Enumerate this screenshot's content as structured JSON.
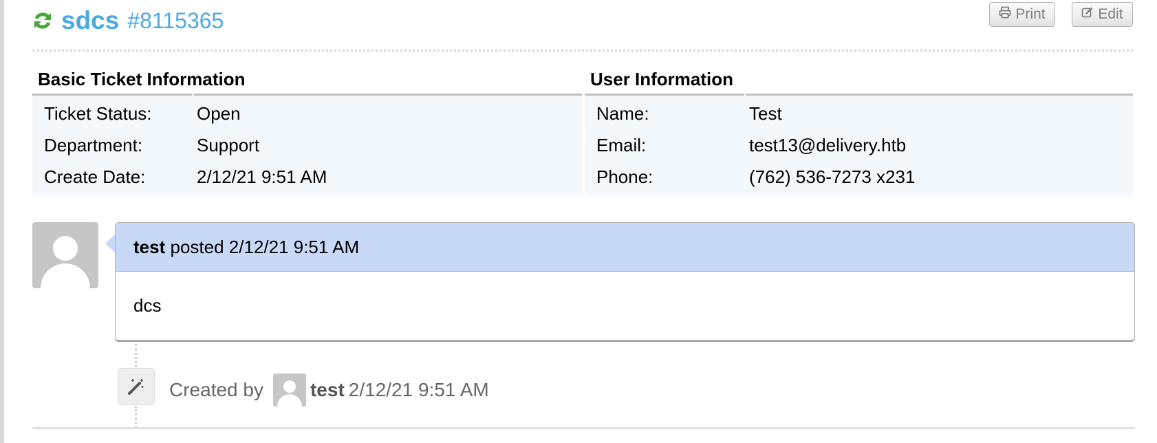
{
  "ticket": {
    "title": "sdcs",
    "number": "#8115365"
  },
  "header_buttons": {
    "print_label": "Print",
    "edit_label": "Edit"
  },
  "basic_info": {
    "heading": "Basic Ticket Information",
    "rows": [
      {
        "label": "Ticket Status:",
        "value": "Open"
      },
      {
        "label": "Department:",
        "value": "Support"
      },
      {
        "label": "Create Date:",
        "value": "2/12/21 9:51 AM"
      }
    ]
  },
  "user_info": {
    "heading": "User Information",
    "rows": [
      {
        "label": "Name:",
        "value": "Test"
      },
      {
        "label": "Email:",
        "value": "test13@delivery.htb"
      },
      {
        "label": "Phone:",
        "value": "(762) 536-7273 x231"
      }
    ]
  },
  "thread_entry": {
    "poster": "test",
    "posted_text": "posted 2/12/21 9:51 AM",
    "body": "dcs"
  },
  "event": {
    "created_by_label": "Created by",
    "user": "test",
    "date": "2/12/21 9:51 AM"
  },
  "icons": {
    "refresh": "refresh-icon",
    "print": "printer-icon",
    "edit": "edit-icon",
    "event": "magic-wand-icon",
    "avatar": "default-avatar-icon"
  },
  "colors": {
    "title": "#4aa8e2",
    "refresh_icon": "#45a835",
    "thread_header_bg": "#c8d8f7",
    "info_table_bg": "#f3f8fd"
  }
}
